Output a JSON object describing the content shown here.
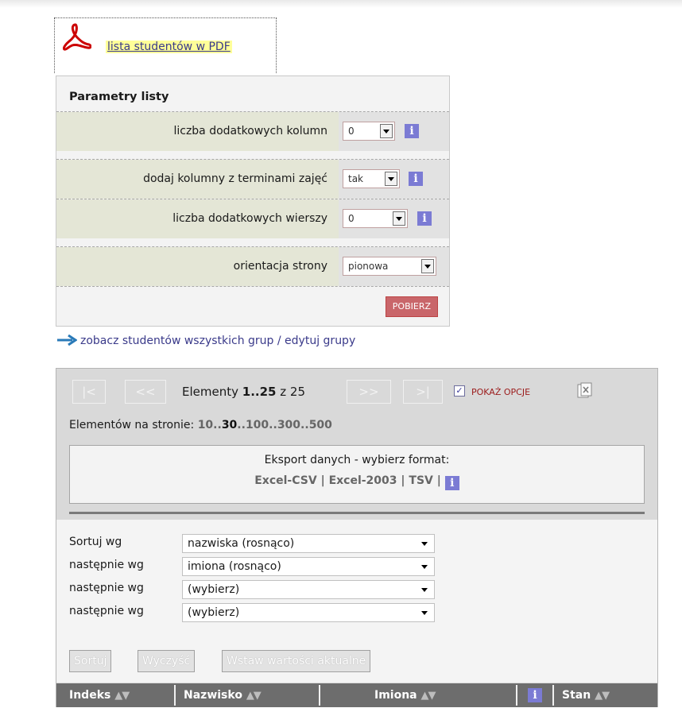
{
  "pdf_link": {
    "label": "lista studentów w PDF"
  },
  "params": {
    "title": "Parametry listy",
    "rows": [
      {
        "label": "liczba dodatkowych kolumn",
        "value": "0"
      },
      {
        "label": "dodaj kolumny z terminami zajęć",
        "value": "tak"
      },
      {
        "label": "liczba dodatkowych wierszy",
        "value": "0"
      },
      {
        "label": "orientacja strony",
        "value": "pionowa"
      }
    ],
    "submit_label": "POBIERZ",
    "info_label": "i"
  },
  "groups_link": {
    "label": "zobacz studentów wszystkich grup / edytuj grupy"
  },
  "pager": {
    "first": "|<",
    "prev": "<<",
    "next": ">>",
    "last": ">|",
    "elements_prefix": "Elementy",
    "range": "1..25",
    "of": "z",
    "total": "25",
    "show_options_checked": "✓",
    "show_options": "POKAŻ OPCJE",
    "per_page_label": "Elementów na stronie:",
    "per_page_options": [
      "10",
      "30",
      "100",
      "300",
      "500"
    ],
    "per_page_separator": "..",
    "per_page_current": "30"
  },
  "export": {
    "title": "Eksport danych - wybierz format:",
    "formats": [
      "Excel-CSV",
      "Excel-2003",
      "TSV"
    ],
    "separator": "|",
    "info_label": "i"
  },
  "sort": {
    "rows": [
      {
        "label": "Sortuj wg",
        "value": "nazwiska (rosnąco)"
      },
      {
        "label": "następnie wg",
        "value": "imiona (rosnąco)"
      },
      {
        "label": "następnie wg",
        "value": "(wybierz)"
      },
      {
        "label": "następnie wg",
        "value": "(wybierz)"
      }
    ],
    "buttons": [
      "Sortuj",
      "Wyczyść",
      "Wstaw wartości aktualne"
    ]
  },
  "table": {
    "headers": [
      "Indeks",
      "Nazwisko",
      "Imiona",
      "i",
      "Stan"
    ],
    "sort_arrows": "▲▼"
  },
  "colors": {
    "info": "#7b7bd4",
    "link": "#3a3a8a",
    "pdf_red": "#cc0000",
    "submit": "#c9666a",
    "header": "#6d6d6d"
  }
}
